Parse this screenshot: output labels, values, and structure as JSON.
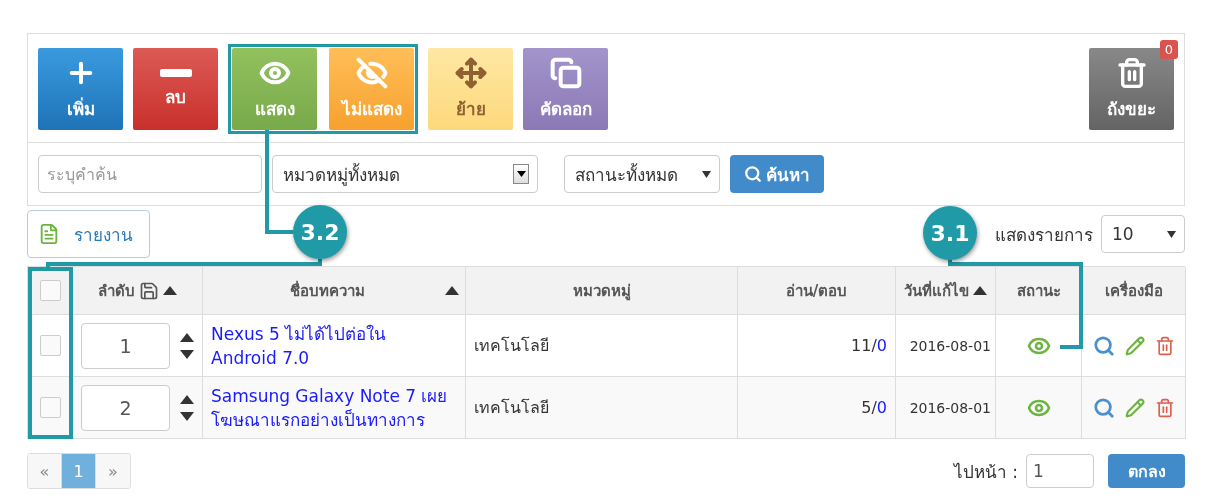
{
  "toolbar": {
    "buttons": [
      {
        "kind": "add",
        "label": "เพิ่ม"
      },
      {
        "kind": "delete",
        "label": "ลบ"
      },
      {
        "kind": "show",
        "label": "แสดง"
      },
      {
        "kind": "hide",
        "label": "ไม่แสดง"
      },
      {
        "kind": "move",
        "label": "ย้าย"
      },
      {
        "kind": "copy",
        "label": "คัดลอก"
      }
    ],
    "trash": {
      "label": "ถังขยะ",
      "count": "0"
    }
  },
  "filters": {
    "search": {
      "placeholder": "ระบุคำค้น"
    },
    "category": "หมวดหมู่ทั้งหมด",
    "status": "สถานะทั้งหมด",
    "search_button": "ค้นหา"
  },
  "report_button": "รายงาน",
  "per_page": {
    "label": "แสดงรายการ",
    "value": "10"
  },
  "table": {
    "columns": [
      {
        "kind": "check",
        "checked": false
      },
      {
        "kind": "order",
        "label": "ลำดับ",
        "sorted": true
      },
      {
        "kind": "title",
        "label": "ชื่อบทความ",
        "sorted": true
      },
      {
        "kind": "category",
        "label": "หมวดหมู่"
      },
      {
        "kind": "reads",
        "label": "อ่าน/ตอบ"
      },
      {
        "kind": "date",
        "label": "วันที่แก้ไข",
        "sorted": true
      },
      {
        "kind": "status",
        "label": "สถานะ"
      },
      {
        "kind": "tools",
        "label": "เครื่องมือ"
      }
    ],
    "rows": [
      {
        "checked": false,
        "order": "1",
        "title": "Nexus 5 ไม่ได้ไปต่อใน Android 7.0",
        "category": "เทคโนโลยี",
        "reads": "11/",
        "replies": "0",
        "date": "2016-08-01",
        "published": true
      },
      {
        "checked": false,
        "order": "2",
        "title": "Samsung Galaxy Note 7 เผยโฆษณาแรกอย่างเป็นทางการ",
        "category": "เทคโนโลยี",
        "reads": "5/",
        "replies": "0",
        "date": "2016-08-01",
        "published": true
      }
    ]
  },
  "pagination": {
    "prev": "«",
    "pages": [
      {
        "label": "1",
        "selected": true
      }
    ],
    "next": "»",
    "goto_label": "ไปหน้า :",
    "goto_value": "1",
    "go_button": "ตกลง"
  },
  "annotations": [
    {
      "label": "3.2"
    },
    {
      "label": "3.1"
    }
  ]
}
